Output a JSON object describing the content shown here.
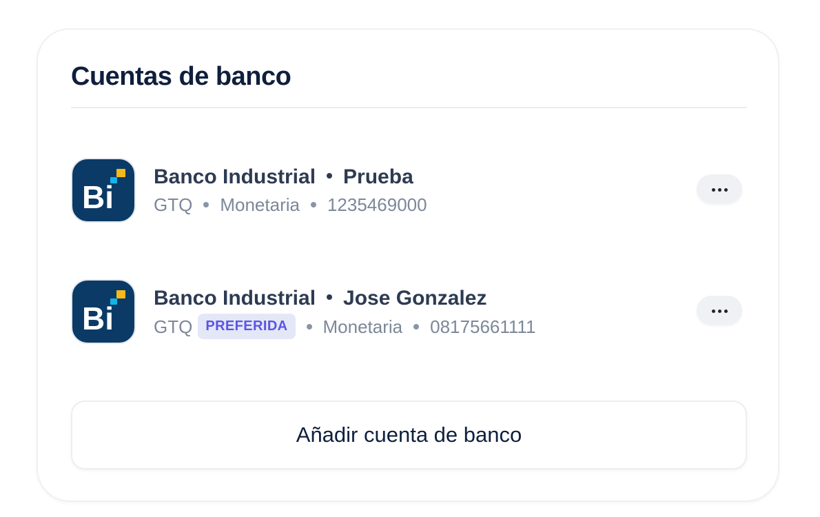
{
  "card": {
    "title": "Cuentas de banco"
  },
  "accounts": [
    {
      "bank": "Banco Industrial",
      "holder": "Prueba",
      "currency": "GTQ",
      "badge": "",
      "type": "Monetaria",
      "number": "1235469000",
      "logo_text": "Bi",
      "more_icon": "more-horizontal-icon"
    },
    {
      "bank": "Banco Industrial",
      "holder": "Jose Gonzalez",
      "currency": "GTQ",
      "badge": "PREFERIDA",
      "type": "Monetaria",
      "number": "08175661111",
      "logo_text": "Bi",
      "more_icon": "more-horizontal-icon"
    }
  ],
  "add_button": {
    "label": "Añadir cuenta de banco"
  },
  "colors": {
    "logo_background": "#0b3a66",
    "logo_accent_yellow": "#f5b919",
    "logo_accent_cyan": "#14b4e6",
    "badge_background": "#e4e7f6",
    "badge_text": "#5b55e6",
    "title_text": "#0f1f3d"
  }
}
